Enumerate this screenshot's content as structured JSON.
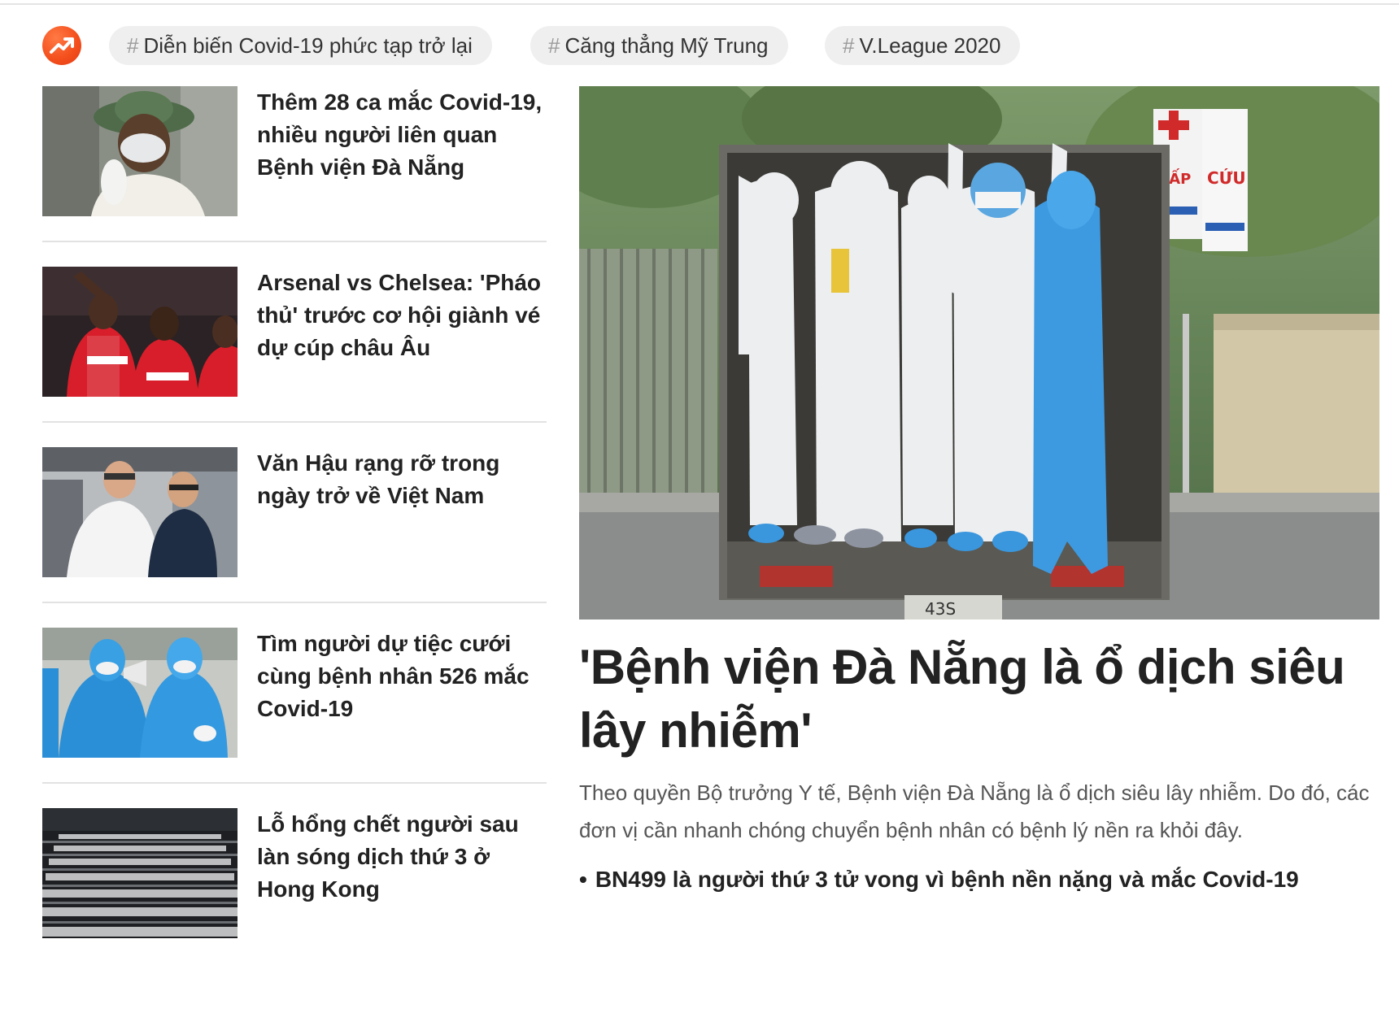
{
  "trending": {
    "logo_icon": "trending-up-icon",
    "tags": [
      {
        "hash": "#",
        "label": "Diễn biến Covid-19 phức tạp trở lại"
      },
      {
        "hash": "#",
        "label": "Căng thẳng Mỹ Trung"
      },
      {
        "hash": "#",
        "label": "V.League 2020"
      }
    ]
  },
  "articles": [
    {
      "headline": "Thêm 28 ca mắc Covid-19, nhiều người liên quan Bệnh viện Đà Nẵng"
    },
    {
      "headline": "Arsenal vs Chelsea: 'Pháo thủ' trước cơ hội giành vé dự cúp châu Âu"
    },
    {
      "headline": "Văn Hậu rạng rỡ trong ngày trở về Việt Nam"
    },
    {
      "headline": "Tìm người dự tiệc cưới cùng bệnh nhân 526 mắc Covid-19"
    },
    {
      "headline": "Lỗ hổng chết người sau làn sóng dịch thứ 3 ở Hong Kong"
    }
  ],
  "featured": {
    "title": "'Bệnh viện Đà Nẵng là ổ dịch siêu lây nhiễm'",
    "summary": "Theo quyền Bộ trưởng Y tế, Bệnh viện Đà Nẵng là ổ dịch siêu lây nhiễm. Do đó, các đơn vị cần nhanh chóng chuyển bệnh nhân có bệnh lý nền ra khỏi đây.",
    "related_bullet": "•",
    "related": "BN499 là người thứ 3 tử vong vì bệnh nền nặng và mắc Covid-19",
    "sign_text_1": "CẤP",
    "sign_text_2": "CỨU",
    "plate_text": "43S"
  },
  "colors": {
    "brand": "#f4511e",
    "tag_bg": "#efefef",
    "text": "#222222",
    "muted": "#555555"
  }
}
